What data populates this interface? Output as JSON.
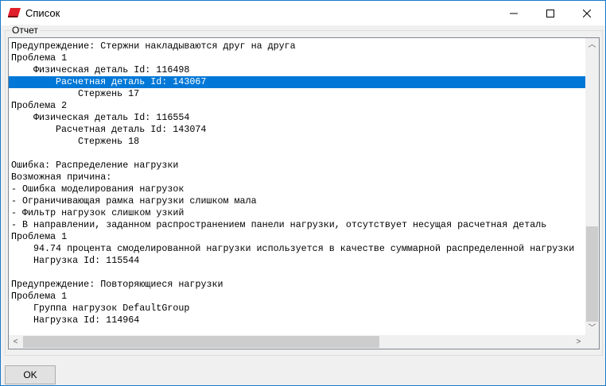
{
  "window": {
    "title": "Список",
    "icon": "app-red-book-icon",
    "minimize": "–",
    "maximize": "☐",
    "close": "✕"
  },
  "group": {
    "label": "Отчет"
  },
  "report": {
    "selected_index": 3,
    "lines": [
      {
        "indent": 0,
        "text": "Предупреждение: Стержни накладываются друг на друга"
      },
      {
        "indent": 0,
        "text": "Проблема 1"
      },
      {
        "indent": 1,
        "text": "Физическая деталь Id: 116498"
      },
      {
        "indent": 2,
        "text": "Расчетная деталь Id: 143067"
      },
      {
        "indent": 3,
        "text": "Стержень 17"
      },
      {
        "indent": 0,
        "text": "Проблема 2"
      },
      {
        "indent": 1,
        "text": "Физическая деталь Id: 116554"
      },
      {
        "indent": 2,
        "text": "Расчетная деталь Id: 143074"
      },
      {
        "indent": 3,
        "text": "Стержень 18"
      },
      {
        "indent": 0,
        "text": ""
      },
      {
        "indent": 0,
        "text": "Ошибка: Распределение нагрузки"
      },
      {
        "indent": 0,
        "text": "Возможная причина:"
      },
      {
        "indent": 0,
        "text": "- Ошибка моделирования нагрузок"
      },
      {
        "indent": 0,
        "text": "- Ограничивающая рамка нагрузки слишком мала"
      },
      {
        "indent": 0,
        "text": "- Фильтр нагрузок слишком узкий"
      },
      {
        "indent": 0,
        "text": "- В направлении, заданном распространением панели нагрузки, отсутствует несущая расчетная деталь"
      },
      {
        "indent": 0,
        "text": "Проблема 1"
      },
      {
        "indent": 1,
        "text": "94.74 процента смоделированной нагрузки используется в качестве суммарной распределенной нагрузки"
      },
      {
        "indent": 1,
        "text": "Нагрузка Id: 115544"
      },
      {
        "indent": 0,
        "text": ""
      },
      {
        "indent": 0,
        "text": "Предупреждение: Повторяющиеся нагрузки"
      },
      {
        "indent": 0,
        "text": "Проблема 1"
      },
      {
        "indent": 1,
        "text": "Группа нагрузок DefaultGroup"
      },
      {
        "indent": 1,
        "text": "Нагрузка Id: 114964"
      }
    ]
  },
  "buttons": {
    "ok": "OK"
  }
}
